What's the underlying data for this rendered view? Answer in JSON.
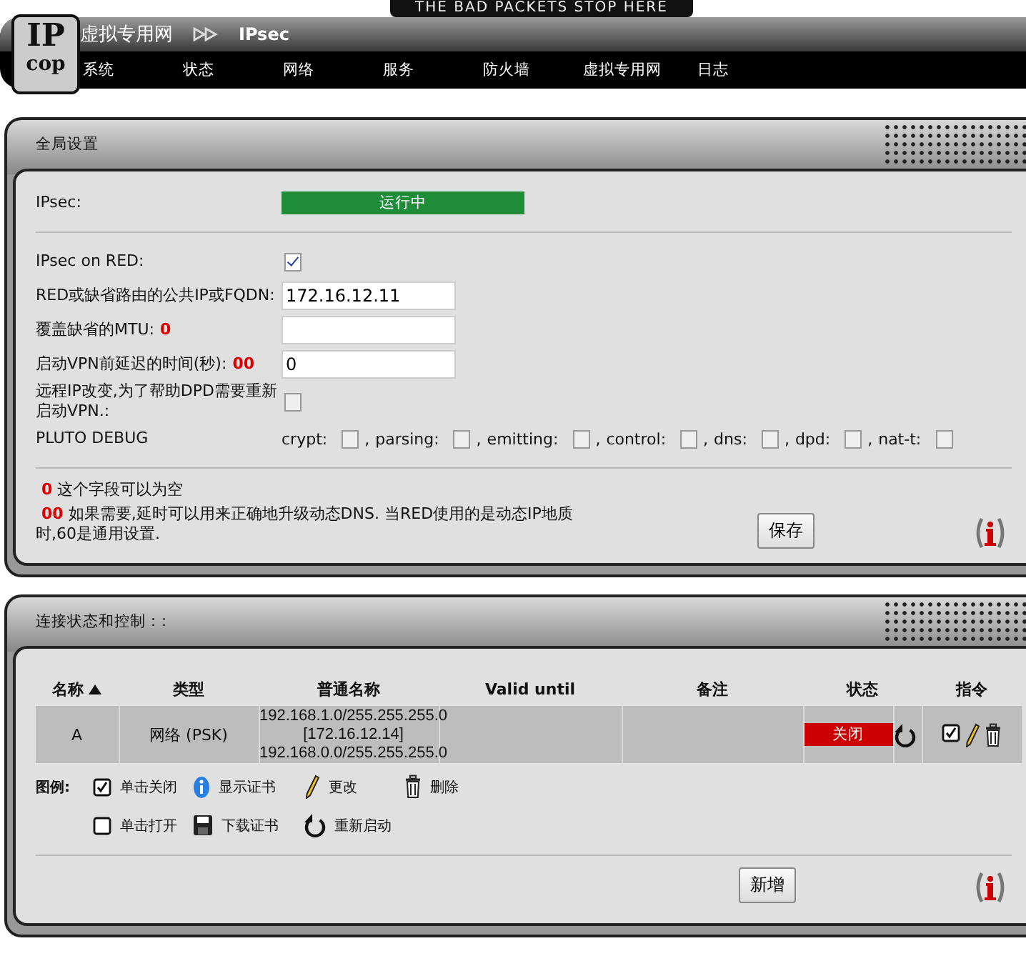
{
  "header": {
    "tagline": "THE BAD PACKETS STOP HERE",
    "logo": {
      "top": "IP",
      "bottom": "cop"
    },
    "section": "虚拟专用网",
    "page": "IPsec",
    "menu": [
      "系统",
      "状态",
      "网络",
      "服务",
      "防火墙",
      "虚拟专用网",
      "日志"
    ]
  },
  "global_settings": {
    "title": "全局设置",
    "status": {
      "label": "IPsec:",
      "text": "运行中",
      "on": true
    },
    "fields": [
      {
        "kind": "checkbox",
        "label": "IPsec on RED:",
        "checked": true
      },
      {
        "kind": "text",
        "label": "RED或缺省路由的公共IP或FQDN:",
        "value": "172.16.12.11"
      },
      {
        "kind": "text",
        "label": "覆盖缺省的MTU:",
        "mark": "0"
      },
      {
        "kind": "text",
        "label": "启动VPN前延迟的时间(秒):",
        "mark": "00",
        "value": "0"
      },
      {
        "kind": "checkbox",
        "label": "远程IP改变,为了帮助DPD需要重新启动VPN.:",
        "checked": false
      }
    ],
    "debug": {
      "label": "PLUTO DEBUG",
      "separator": ",",
      "options": [
        {
          "label": "crypt:",
          "checked": false
        },
        {
          "label": "parsing:",
          "checked": false
        },
        {
          "label": "emitting:",
          "checked": false
        },
        {
          "label": "control:",
          "checked": false
        },
        {
          "label": "dns:",
          "checked": false
        },
        {
          "label": "dpd:",
          "checked": false
        },
        {
          "label": "nat-t:",
          "checked": false
        }
      ]
    },
    "notes": [
      {
        "mark": "0",
        "text": "这个字段可以为空"
      },
      {
        "mark": "00",
        "text": "如果需要,延时可以用来正确地升级动态DNS. 当RED使用的是动态IP地质时,60是通用设置."
      }
    ],
    "save_button": "保存"
  },
  "connections": {
    "title": "连接状态和控制：:",
    "columns": [
      {
        "label": "名称",
        "sorted": true
      },
      {
        "label": "类型",
        "sorted": false
      },
      {
        "label": "普通名称",
        "sorted": false
      },
      {
        "label": "Valid until",
        "sorted": false
      },
      {
        "label": "备注",
        "sorted": false
      },
      {
        "label": "状态",
        "sorted": false
      },
      {
        "label": "指令",
        "sorted": false
      }
    ],
    "rows": [
      {
        "name": "A",
        "type": "网络 (PSK)",
        "common_name": [
          "192.168.1.0/255.255.255.0",
          "[172.16.12.14]",
          "192.168.0.0/255.255.255.0"
        ],
        "status": {
          "text": "关闭",
          "on": false
        },
        "enabled": true
      }
    ],
    "legend": {
      "label": "图例:",
      "items": [
        {
          "kind": "checked",
          "label": "单击关闭"
        },
        {
          "kind": "info",
          "label": "显示证书"
        },
        {
          "kind": "edit",
          "label": "更改"
        },
        {
          "kind": "delete",
          "label": "删除"
        },
        {
          "kind": "unchecked",
          "label": "单击打开"
        },
        {
          "kind": "save",
          "label": "下载证书"
        },
        {
          "kind": "restart",
          "label": "重新启动"
        }
      ]
    },
    "add_button": "新增"
  }
}
